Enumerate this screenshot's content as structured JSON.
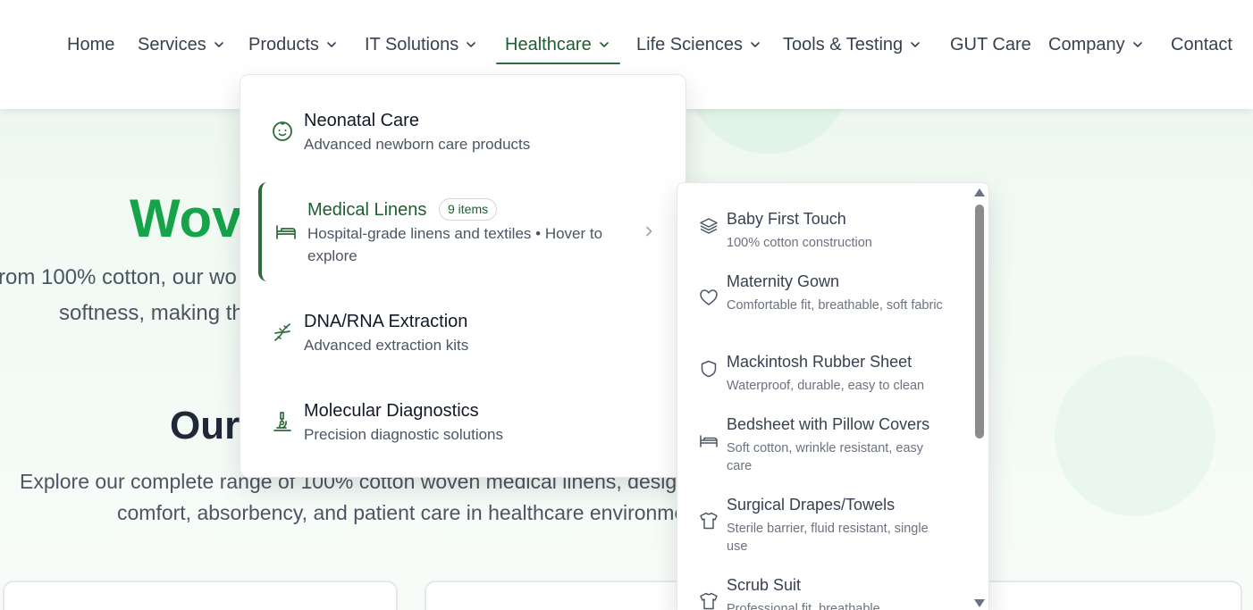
{
  "colors": {
    "brand_green": "#16a34a",
    "accent_dark_green": "#2f6b3b",
    "nav_text": "#374151",
    "hero_bg": "#eef8f1"
  },
  "nav": {
    "items": [
      {
        "label": "Home",
        "icon": null
      },
      {
        "label": "Services",
        "icon": "chevron-down-icon"
      },
      {
        "label": "Products",
        "icon": "chevron-down-icon"
      },
      {
        "label": "IT Solutions",
        "icon": "chevron-down-icon"
      },
      {
        "label": "Healthcare",
        "icon": "chevron-down-icon",
        "active": true
      },
      {
        "label": "Life Sciences",
        "icon": "chevron-down-icon"
      },
      {
        "label": "Tools & Testing",
        "icon": "chevron-down-icon"
      },
      {
        "label": "GUT Care",
        "icon": null
      },
      {
        "label": "Company",
        "icon": "chevron-down-icon"
      },
      {
        "label": "Contact",
        "icon": null
      }
    ]
  },
  "hero": {
    "title_partial": "Wov",
    "text_line1": "rom 100% cotton, our wo",
    "text_line2": "softness, making th",
    "section_title_partial": "Our",
    "section_text_line1": "Explore our complete range of 100% cotton woven medical linens, designe",
    "section_text_line2": "comfort, absorbency, and patient care in healthcare environmen"
  },
  "dropdown": {
    "items": [
      {
        "title": "Neonatal Care",
        "desc": "Advanced newborn care products",
        "icon": "baby-face-icon"
      },
      {
        "title": "Medical Linens",
        "badge": "9 items",
        "desc_line1": "Hospital-grade linens and textiles • Hover to",
        "desc_line2": "explore",
        "icon": "bed-icon",
        "active": true
      },
      {
        "title": "DNA/RNA Extraction",
        "desc": "Advanced extraction kits",
        "icon": "dna-icon"
      },
      {
        "title": "Molecular Diagnostics",
        "desc": "Precision diagnostic solutions",
        "icon": "microscope-icon"
      }
    ]
  },
  "submenu": {
    "items": [
      {
        "title": "Baby First Touch",
        "desc": "100% cotton construction",
        "icon": "layers-icon"
      },
      {
        "title": "Maternity Gown",
        "desc": "Comfortable fit, breathable, soft fabric",
        "icon": "heart-icon"
      },
      {
        "title": "Mackintosh Rubber Sheet",
        "desc": "Waterproof, durable, easy to clean",
        "icon": "shield-icon"
      },
      {
        "title": "Bedsheet with Pillow Covers",
        "desc": "Soft cotton, wrinkle resistant, easy care",
        "icon": "bed-icon"
      },
      {
        "title": "Surgical Drapes/Towels",
        "desc": "Sterile barrier, fluid resistant, single use",
        "icon": "shirt-icon"
      },
      {
        "title": "Scrub Suit",
        "desc": "Professional fit, breathable,",
        "icon": "shirt-icon"
      }
    ]
  }
}
